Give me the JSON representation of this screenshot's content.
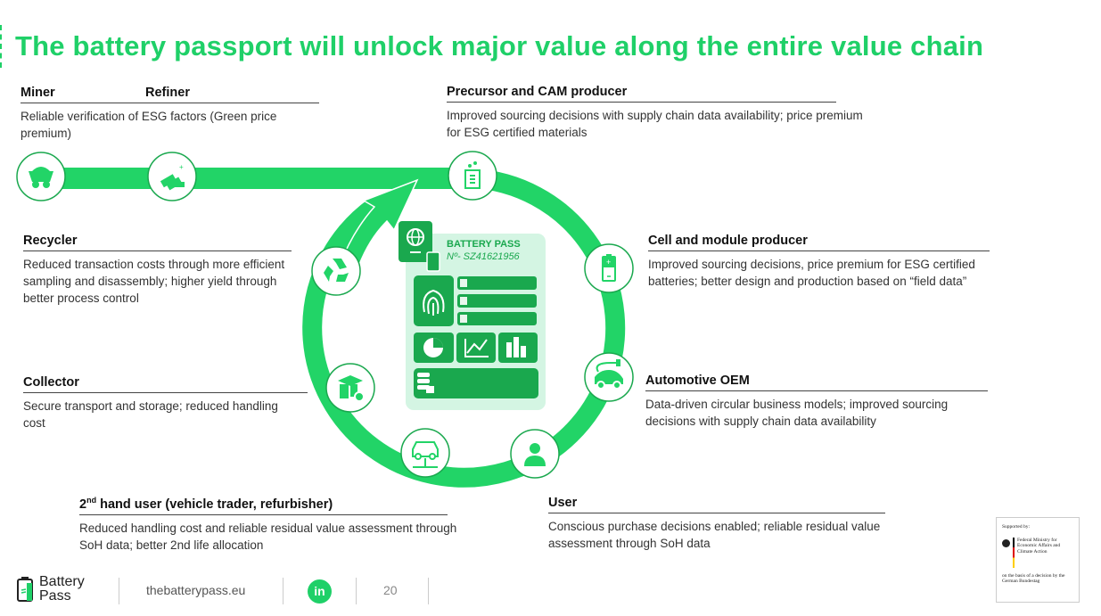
{
  "title": "The battery passport will unlock major value along the entire value chain",
  "colors": {
    "brand_green": "#1fd068",
    "dark_green": "#1aa84e",
    "card_bg": "#d4f5e3",
    "ring_stroke": "#1aa84e"
  },
  "stages": {
    "miner": {
      "label": "Miner",
      "icon": "mining-cart-icon"
    },
    "refiner": {
      "label": "Refiner",
      "icon": "gold-bars-icon",
      "desc": "Reliable verification of ESG factors (Green price premium)"
    },
    "precursor": {
      "label": "Precursor and CAM producer",
      "icon": "beaker-icon",
      "desc": "Improved sourcing decisions with supply chain data availability; price premium for ESG certified materials"
    },
    "cell": {
      "label": "Cell and module producer",
      "icon": "battery-icon",
      "desc": "Improved sourcing decisions, price premium for ESG certified batteries; better design and production based on “field data”"
    },
    "oem": {
      "label": "Automotive OEM",
      "icon": "electric-car-icon",
      "desc": "Data-driven circular business models; improved sourcing decisions with supply chain data availability"
    },
    "user": {
      "label": "User",
      "icon": "person-icon",
      "desc": "Conscious purchase decisions enabled; reliable residual value assessment through SoH data"
    },
    "secondhand": {
      "label_main": "2",
      "label_sup": "nd",
      "label_rest": " hand user (vehicle trader, refurbisher)",
      "icon": "car-lift-icon",
      "desc": "Reduced handling cost and reliable residual value assessment through SoH data; better 2nd life allocation"
    },
    "collector": {
      "label": "Collector",
      "icon": "box-gear-icon",
      "desc": "Secure transport and storage; reduced handling cost"
    },
    "recycler": {
      "label": "Recycler",
      "icon": "recycle-icon",
      "desc": "Reduced transaction costs through more efficient sampling and disassembly; higher yield through better process control"
    }
  },
  "passport_card": {
    "title": "BATTERY PASS",
    "number": "Nº- SZ41621956"
  },
  "footer": {
    "logo_line1": "Battery",
    "logo_line2": "Pass",
    "url": "thebatterypass.eu",
    "social": "in",
    "page": "20"
  },
  "support": {
    "supported_by": "Supported by:",
    "ministry": "Federal Ministry for Economic Affairs and Climate Action",
    "basis": "on the basis of a decision by the German Bundestag"
  }
}
